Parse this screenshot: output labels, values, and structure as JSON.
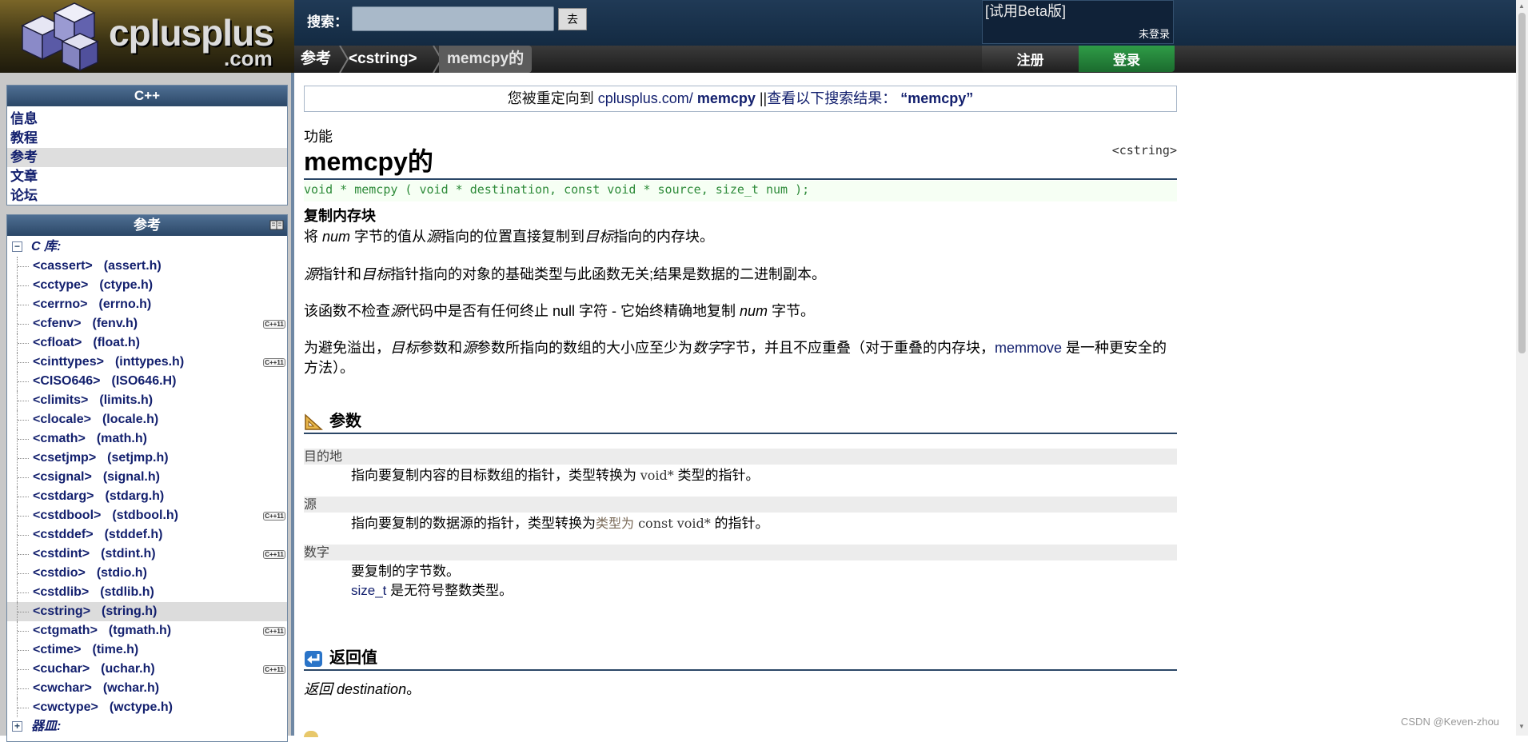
{
  "header": {
    "brand": "cplusplus",
    "brand_suffix": ".com",
    "search_label": "搜索：",
    "search_placeholder": "",
    "search_button": "去",
    "beta_label": "[试用Beta版]",
    "login_status": "未登录",
    "register_button": "注册",
    "login_button": "登录",
    "breadcrumbs": [
      "参考",
      "<cstring>",
      "memcpy的"
    ]
  },
  "sidebar": {
    "cpp_panel_title": "C++",
    "nav_items": [
      "信息",
      "教程",
      "参考",
      "文章",
      "论坛"
    ],
    "active_nav": "参考",
    "ref_panel_title": "参考",
    "c_library_label": "C 库:",
    "libraries": [
      {
        "header": "<cassert>",
        "alt": "(assert.h)",
        "cpp11": false
      },
      {
        "header": "<cctype>",
        "alt": "(ctype.h)",
        "cpp11": false
      },
      {
        "header": "<cerrno>",
        "alt": "(errno.h)",
        "cpp11": false
      },
      {
        "header": "<cfenv>",
        "alt": "(fenv.h)",
        "cpp11": true
      },
      {
        "header": "<cfloat>",
        "alt": "(float.h)",
        "cpp11": false
      },
      {
        "header": "<cinttypes>",
        "alt": "(inttypes.h)",
        "cpp11": true
      },
      {
        "header": "<CISO646>",
        "alt": "(ISO646.H)",
        "cpp11": false
      },
      {
        "header": "<climits>",
        "alt": "(limits.h)",
        "cpp11": false
      },
      {
        "header": "<clocale>",
        "alt": "(locale.h)",
        "cpp11": false
      },
      {
        "header": "<cmath>",
        "alt": "(math.h)",
        "cpp11": false
      },
      {
        "header": "<csetjmp>",
        "alt": "(setjmp.h)",
        "cpp11": false
      },
      {
        "header": "<csignal>",
        "alt": "(signal.h)",
        "cpp11": false
      },
      {
        "header": "<cstdarg>",
        "alt": "(stdarg.h)",
        "cpp11": false
      },
      {
        "header": "<cstdbool>",
        "alt": "(stdbool.h)",
        "cpp11": true
      },
      {
        "header": "<cstddef>",
        "alt": "(stddef.h)",
        "cpp11": false
      },
      {
        "header": "<cstdint>",
        "alt": "(stdint.h)",
        "cpp11": true
      },
      {
        "header": "<cstdio>",
        "alt": "(stdio.h)",
        "cpp11": false
      },
      {
        "header": "<cstdlib>",
        "alt": "(stdlib.h)",
        "cpp11": false
      },
      {
        "header": "<cstring>",
        "alt": "(string.h)",
        "cpp11": false,
        "active": true
      },
      {
        "header": "<ctgmath>",
        "alt": "(tgmath.h)",
        "cpp11": true
      },
      {
        "header": "<ctime>",
        "alt": "(time.h)",
        "cpp11": false
      },
      {
        "header": "<cuchar>",
        "alt": "(uchar.h)",
        "cpp11": true
      },
      {
        "header": "<cwchar>",
        "alt": "(wchar.h)",
        "cpp11": false
      },
      {
        "header": "<cwctype>",
        "alt": "(wctype.h)",
        "cpp11": false
      }
    ],
    "containers_label": "器皿:",
    "cpp11_badge": "C++11"
  },
  "main": {
    "redirect": {
      "prefix": "您被重定向到 ",
      "site": "cplusplus.com/ ",
      "target": "memcpy",
      "separator": " ||",
      "search_text": "查看以下搜索结果：",
      "query": " “memcpy”"
    },
    "type_label": "功能",
    "title": "memcpy的",
    "header_ref": "<cstring>",
    "prototype": "void * memcpy ( void * destination, const void * source, size_t num );",
    "short_desc": "复制内存块",
    "para1": {
      "a": "将 ",
      "b": "num",
      "c": " 字节的值从",
      "d": "源",
      "e": "指向的位置直接复制到",
      "f": "目标",
      "g": "指向的内存块。"
    },
    "para2": {
      "a": "源",
      "b": "指针和",
      "c": "目标",
      "d": "指针指向的对象的基础类型与此函数无关;结果是数据的二进制副本。"
    },
    "para3": {
      "a": "该函数不检查",
      "b": "源",
      "c": "代码中是否有任何终止 null 字符 - 它始终精确地复制 ",
      "d": "num",
      "e": " 字节。"
    },
    "para4": {
      "a": "为避免溢出，",
      "b": "目标",
      "c": "参数和",
      "d": "源",
      "e": "参数所指向的数组的大小应至少为",
      "f": "数字",
      "g": "字节，并且不应重叠（对于重叠的内存块，",
      "h": "memmove",
      "i": " 是一种更安全的方法）。"
    },
    "params_title": "参数",
    "params": [
      {
        "name": "目的地",
        "desc_a": "指向要复制内容的目标数组的指针，类型转换为 ",
        "desc_code": "void*",
        "desc_b": " 类型的指针。"
      },
      {
        "name": "源",
        "desc_a": "指向要复制的数据源的指针，类型转换为",
        "desc_type": "类型为 ",
        "desc_code": "const void*",
        "desc_b": " 的指针。"
      },
      {
        "name": "数字",
        "desc_a": "要复制的字节数。",
        "desc_link": "size_t",
        "desc_b": " 是无符号整数类型。"
      }
    ],
    "return_title": "返回值",
    "return_a": "返回 ",
    "return_b": "destination",
    "return_c": "。"
  },
  "watermark": "CSDN @Keven-zhou",
  "colors": {
    "nav_blue": "#13206e",
    "header_dark": "#132a42",
    "login_green": "#1b6b2e",
    "proto_green": "#2e8b3a"
  }
}
